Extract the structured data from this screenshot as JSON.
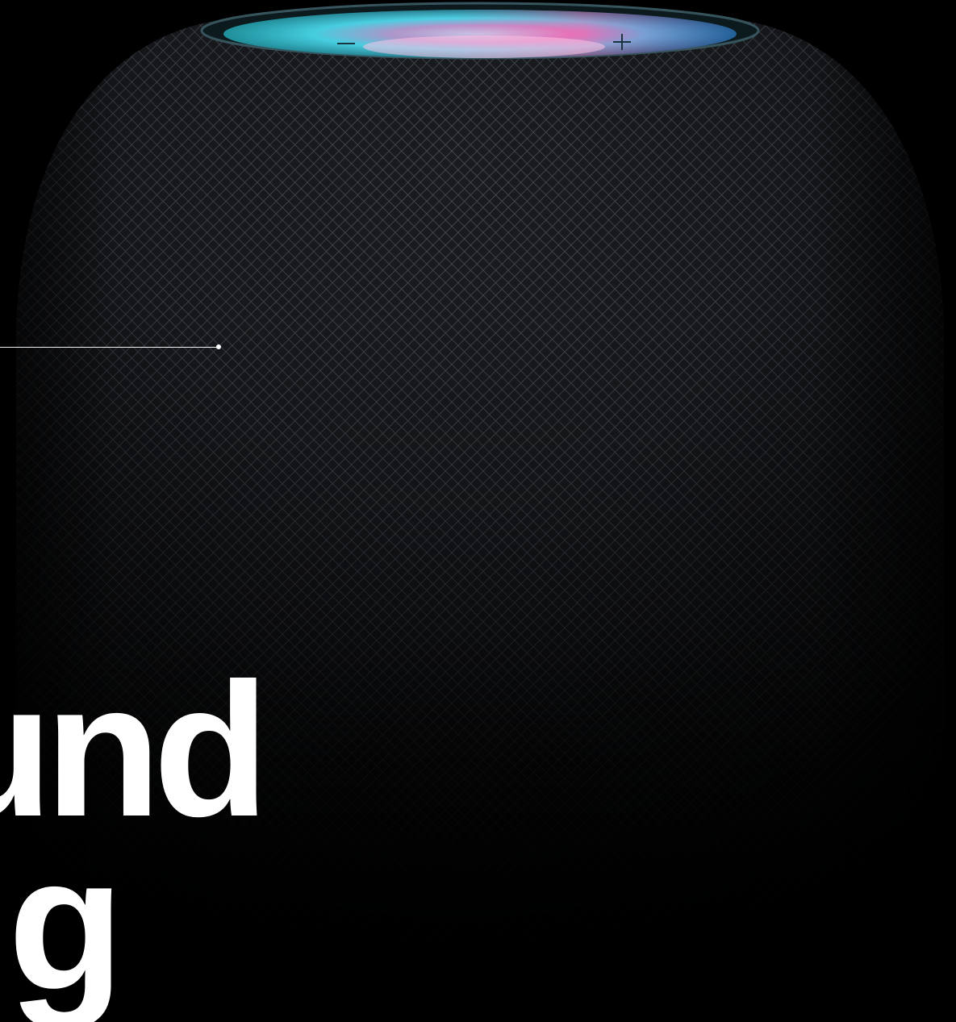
{
  "hero": {
    "headline_lines": [
      "und",
      "g"
    ]
  },
  "colors": {
    "background": "#000000",
    "fabric": "#2a2d33",
    "fabric_highlight": "#4a4f57",
    "glow_cyan": "#38d6e8",
    "glow_pink": "#f05da8",
    "glow_blue": "#3a7be8",
    "text": "#ffffff"
  },
  "product": {
    "icon": "homepod-speaker"
  }
}
